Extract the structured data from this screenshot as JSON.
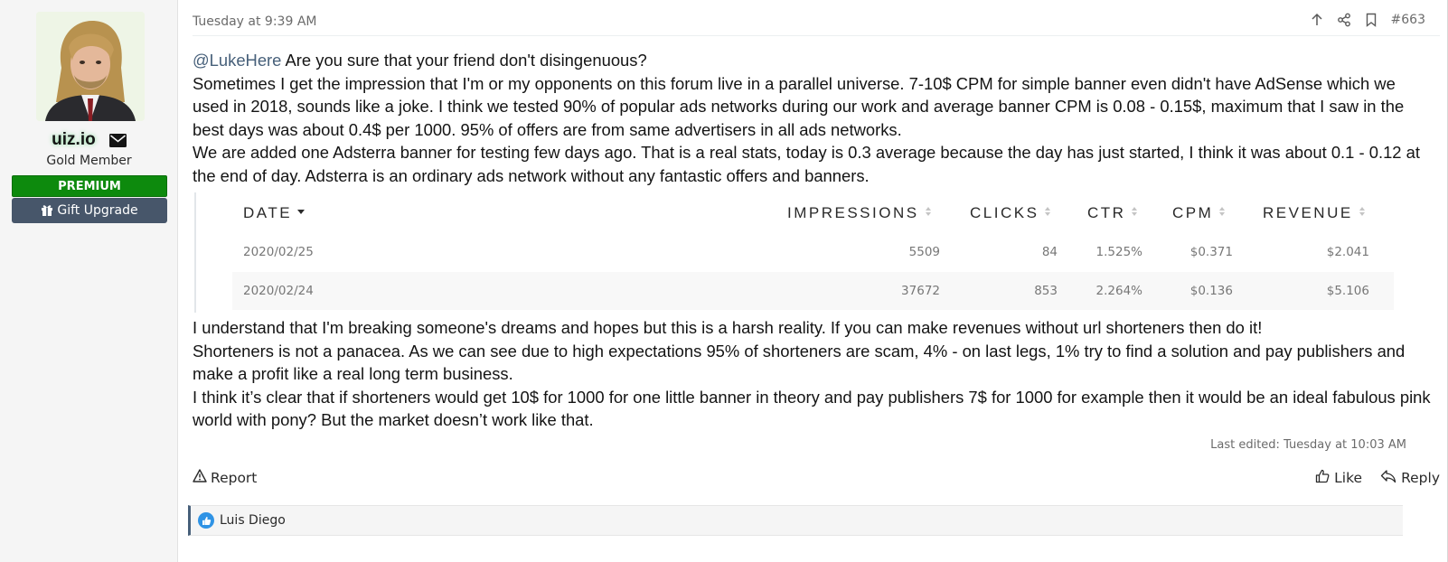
{
  "user": {
    "username": "uiz.io",
    "title": "Gold Member",
    "banner": "PREMIUM",
    "gift_label": "Gift Upgrade"
  },
  "post": {
    "date": "Tuesday at 9:39 AM",
    "number": "#663",
    "mention": "@LukeHere",
    "intro": " Are you sure that your friend don't disingenuous?",
    "paragraph1": "Sometimes I get the impression that I'm or my opponents on this forum live in a parallel universe. 7-10$ CPM for simple banner even didn't have AdSense which we used in 2018, sounds like a joke. I think we tested 90% of popular ads networks during our work and average banner CPM is 0.08 - 0.15$, maximum that I saw in the best days was about 0.4$ per 1000. 95% of offers are from same advertisers in all ads networks.",
    "paragraph2": "We are added one Adsterra banner for testing few days ago. That is a real stats, today is 0.3 average because the day has just started, I think it was about 0.1 - 0.12 at the end of day. Adsterra is an ordinary ads network without any fantastic offers and banners.",
    "paragraph3": "I understand that I'm breaking someone's dreams and hopes but this is a harsh reality. If you can make revenues without url shorteners then do it!",
    "paragraph4": "Shorteners is not a panacea. As we can see due to high expectations 95% of shorteners are scam, 4% - on last legs, 1% try to find a solution and pay publishers and make a profit like a real long term business.",
    "paragraph5": "I think it’s clear that if shorteners would get 10$ for 1000 for one little banner in theory and pay publishers 7$ for 1000 for example then it would be an ideal fabulous pink world with pony? But the market doesn’t work like that.",
    "last_edited": "Last edited: Tuesday at 10:03 AM"
  },
  "table": {
    "headers": [
      "DATE",
      "IMPRESSIONS",
      "CLICKS",
      "CTR",
      "CPM",
      "REVENUE"
    ],
    "rows": [
      [
        "2020/02/25",
        "5509",
        "84",
        "1.525%",
        "$0.371",
        "$2.041"
      ],
      [
        "2020/02/24",
        "37672",
        "853",
        "2.264%",
        "$0.136",
        "$5.106"
      ]
    ]
  },
  "actions": {
    "report": "Report",
    "like": "Like",
    "reply": "Reply"
  },
  "reactions": {
    "users": "Luis Diego"
  },
  "colors": {
    "premium": "#0d8a0d",
    "gift": "#47566a",
    "mention": "#47607a",
    "like_badge": "#2f93e5"
  },
  "icons": [
    "envelope-icon",
    "gift-icon",
    "arrow-up-icon",
    "share-icon",
    "bookmark-icon",
    "warning-icon",
    "thumbs-up-icon",
    "reply-icon",
    "sort-desc-icon",
    "sort-icon"
  ]
}
